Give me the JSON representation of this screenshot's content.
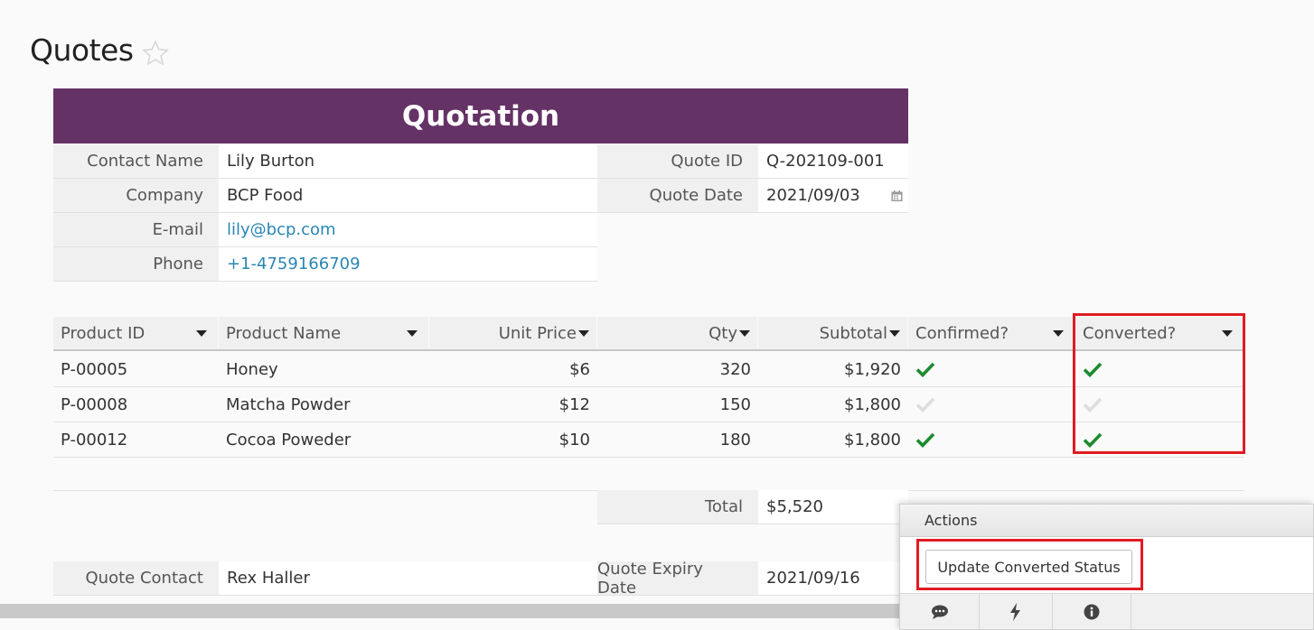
{
  "page": {
    "title": "Quotes"
  },
  "banner": {
    "title": "Quotation"
  },
  "contact": {
    "name_label": "Contact Name",
    "name": "Lily Burton",
    "company_label": "Company",
    "company": "BCP Food",
    "email_label": "E-mail",
    "email": "lily@bcp.com",
    "phone_label": "Phone",
    "phone": "+1-4759166709"
  },
  "quote": {
    "id_label": "Quote ID",
    "id": "Q-202109-001",
    "date_label": "Quote Date",
    "date": "2021/09/03"
  },
  "grid": {
    "columns": [
      "Product ID",
      "Product Name",
      "Unit Price",
      "Qty",
      "Subtotal",
      "Confirmed?",
      "Converted?"
    ],
    "rows": [
      {
        "product_id": "P-00005",
        "product_name": "Honey",
        "unit_price": "$6",
        "qty": "320",
        "subtotal": "$1,920",
        "confirmed": true,
        "converted": true
      },
      {
        "product_id": "P-00008",
        "product_name": "Matcha Powder",
        "unit_price": "$12",
        "qty": "150",
        "subtotal": "$1,800",
        "confirmed": false,
        "converted": false
      },
      {
        "product_id": "P-00012",
        "product_name": "Cocoa Poweder",
        "unit_price": "$10",
        "qty": "180",
        "subtotal": "$1,800",
        "confirmed": true,
        "converted": true
      }
    ]
  },
  "totals": {
    "total_label": "Total",
    "total": "$5,520"
  },
  "footer_fields": {
    "quote_contact_label": "Quote Contact",
    "quote_contact": "Rex Haller",
    "expiry_label": "Quote Expiry Date",
    "expiry": "2021/09/16"
  },
  "actions": {
    "title": "Actions",
    "update_button": "Update Converted Status",
    "footer_icons": [
      "comment-icon",
      "bolt-icon",
      "info-icon"
    ]
  },
  "colors": {
    "banner": "#653266",
    "check_on": "#1e8a2e",
    "check_off": "#dddddd",
    "highlight": "#e01b23",
    "link": "#2a86b5"
  }
}
